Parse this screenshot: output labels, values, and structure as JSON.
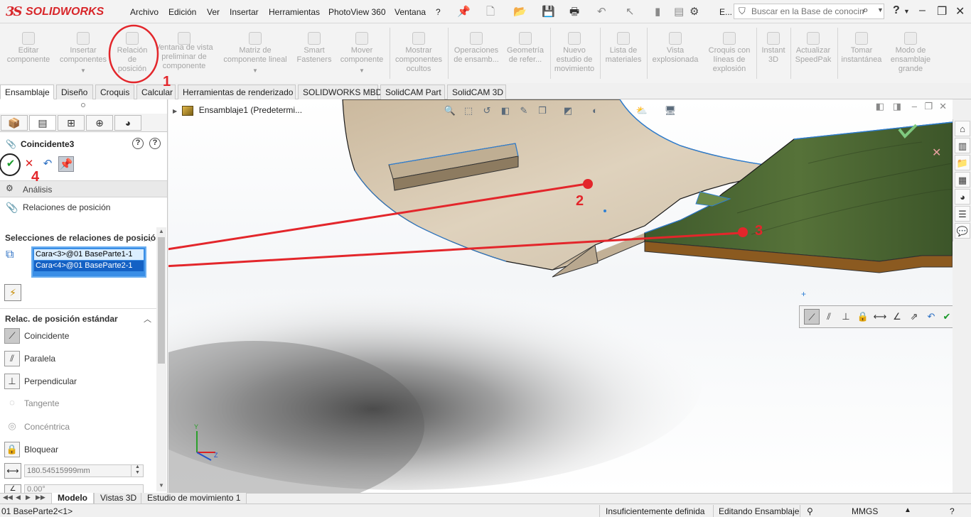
{
  "app": {
    "logo_mark": "3S",
    "logo_text": "SOLIDWORKS"
  },
  "menu": [
    "Archivo",
    "Edición",
    "Ver",
    "Insertar",
    "Herramientas",
    "PhotoView 360",
    "Ventana",
    "?"
  ],
  "toolbar": {
    "e_label": "E..."
  },
  "search": {
    "placeholder": "Buscar en la Base de conocimientos"
  },
  "commands": [
    {
      "label": "Editar\ncomponente"
    },
    {
      "label": "Insertar\ncomponentes"
    },
    {
      "label": "Relación\nde\nposición"
    },
    {
      "label": "Ventana de vista\npreliminar de\ncomponente"
    },
    {
      "label": "Matriz de\ncomponente lineal"
    },
    {
      "label": "Smart\nFasteners"
    },
    {
      "label": "Mover\ncomponente"
    },
    {
      "label": "Mostrar\ncomponentes\nocultos"
    },
    {
      "label": "Operaciones\nde ensamb..."
    },
    {
      "label": "Geometría\nde refer..."
    },
    {
      "label": "Nuevo\nestudio de\nmovimiento"
    },
    {
      "label": "Lista de\nmateriales"
    },
    {
      "label": "Vista\nexplosionada"
    },
    {
      "label": "Croquis con\nlíneas de\nexplosión"
    },
    {
      "label": "Instant\n3D"
    },
    {
      "label": "Actualizar\nSpeedPak"
    },
    {
      "label": "Tomar\ninstantánea"
    },
    {
      "label": "Modo de\nensamblaje\ngrande"
    }
  ],
  "tabs": [
    "Ensamblaje",
    "Diseño",
    "Croquis",
    "Calcular",
    "Herramientas de renderizado",
    "SOLIDWORKS MBD",
    "SolidCAM Part",
    "SolidCAM 3D"
  ],
  "property_manager": {
    "title": "Coincidente3",
    "help": "?",
    "analysis_header": "Análisis",
    "mates_header": "Relaciones de posición",
    "selections_title": "Selecciones de relaciones de posición",
    "selections": [
      "Cara<3>@01 BaseParte1-1",
      "Cara<4>@01 BaseParte2-1"
    ],
    "standard_title": "Relac. de posición estándar",
    "standard_mates": [
      "Coincidente",
      "Paralela",
      "Perpendicular",
      "Tangente",
      "Concéntrica",
      "Bloquear"
    ],
    "distance_value": "180.54515999mm",
    "angle_value": "0.00°"
  },
  "feature_tree": {
    "root": "Ensamblaje1  (Predetermi..."
  },
  "bottom_tabs": [
    "Modelo",
    "Vistas 3D",
    "Estudio de movimiento 1"
  ],
  "status": {
    "left": "01 BaseParte2<1>",
    "definition": "Insuficientemente definida",
    "mode": "Editando Ensamblaje",
    "units": "MMGS"
  },
  "annotations": [
    "1",
    "2",
    "3",
    "4"
  ],
  "colors": {
    "brand": "#d8262a",
    "annotation": "#e3262b",
    "selection": "#1461c4",
    "wood_light": "#d8c9b3",
    "wood_dark": "#4b6432"
  }
}
